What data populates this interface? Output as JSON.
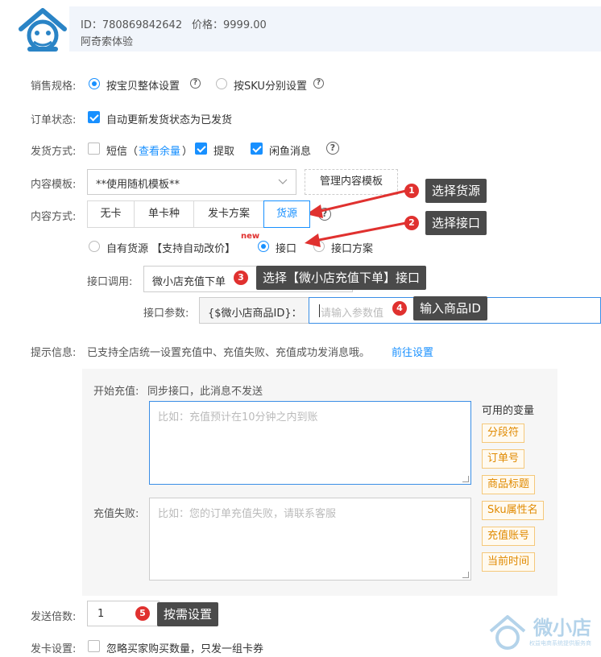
{
  "header": {
    "id_text": "ID：780869842642",
    "price_text": "价格：9999.00",
    "title": "阿奇索体验"
  },
  "sale_spec": {
    "label": "销售规格:",
    "option1": "按宝贝整体设置",
    "option2": "按SKU分别设置",
    "selected": "按宝贝整体设置"
  },
  "order_status": {
    "label": "订单状态:",
    "checkbox_label": "自动更新发货状态为已发货",
    "checked": true
  },
  "ship_method": {
    "label": "发货方式:",
    "sms_label": "短信",
    "sms_link_open": "（",
    "sms_link": "查看余量",
    "sms_link_close": "）",
    "pickup_label": "提取",
    "xianyu_label": "闲鱼消息"
  },
  "content_template": {
    "label": "内容模板:",
    "selected": "**使用随机模板**",
    "manage_button": "管理内容模板"
  },
  "content_mode": {
    "label": "内容方式:",
    "tabs": [
      "无卡",
      "单卡种",
      "发卡方案",
      "货源"
    ],
    "active": "货源"
  },
  "source": {
    "option1": "自有货源 【支持自动改价】",
    "option2": "接口",
    "option3": "接口方案",
    "new_badge": "new",
    "selected": "接口"
  },
  "api_call": {
    "label": "接口调用:",
    "value": "微小店充值下单"
  },
  "api_param": {
    "label": "接口参数:",
    "param_name": "{$微小店商品ID}：",
    "placeholder": "请输入参数值"
  },
  "hint": {
    "label": "提示信息:",
    "text": "已支持全店统一设置充值中、充值失败、充值成功发消息哦。",
    "link": "前往设置"
  },
  "messages": {
    "start_label": "开始充值:",
    "start_note": "同步接口，此消息不发送",
    "start_placeholder": "比如：充值预计在10分钟之内到账",
    "fail_label": "充值失败:",
    "fail_placeholder": "比如：您的订单充值失败，请联系客服",
    "vars_title": "可用的变量",
    "vars": [
      "分段符",
      "订单号",
      "商品标题",
      "Sku属性名",
      "充值账号",
      "当前时间"
    ]
  },
  "send_multiple": {
    "label": "发送倍数:",
    "value": "1"
  },
  "card_setting": {
    "label": "发卡设置:",
    "checkbox_label": "忽略买家购买数量，只发一组卡券"
  },
  "callouts": [
    {
      "num": "1",
      "text": "选择货源"
    },
    {
      "num": "2",
      "text": "选择接口"
    },
    {
      "num": "3",
      "text": "选择【微小店充值下单】接口"
    },
    {
      "num": "4",
      "text": "输入商品ID"
    },
    {
      "num": "5",
      "text": "按需设置"
    }
  ],
  "watermark": {
    "brand": "微小店",
    "sub": "权益电商系统提供服务商"
  },
  "colors": {
    "accent": "#1890ff",
    "callout_bg": "#4a4a4a",
    "callout_dot": "#e0312f",
    "arrow": "#e0312f",
    "tag_text": "#e08a00"
  }
}
